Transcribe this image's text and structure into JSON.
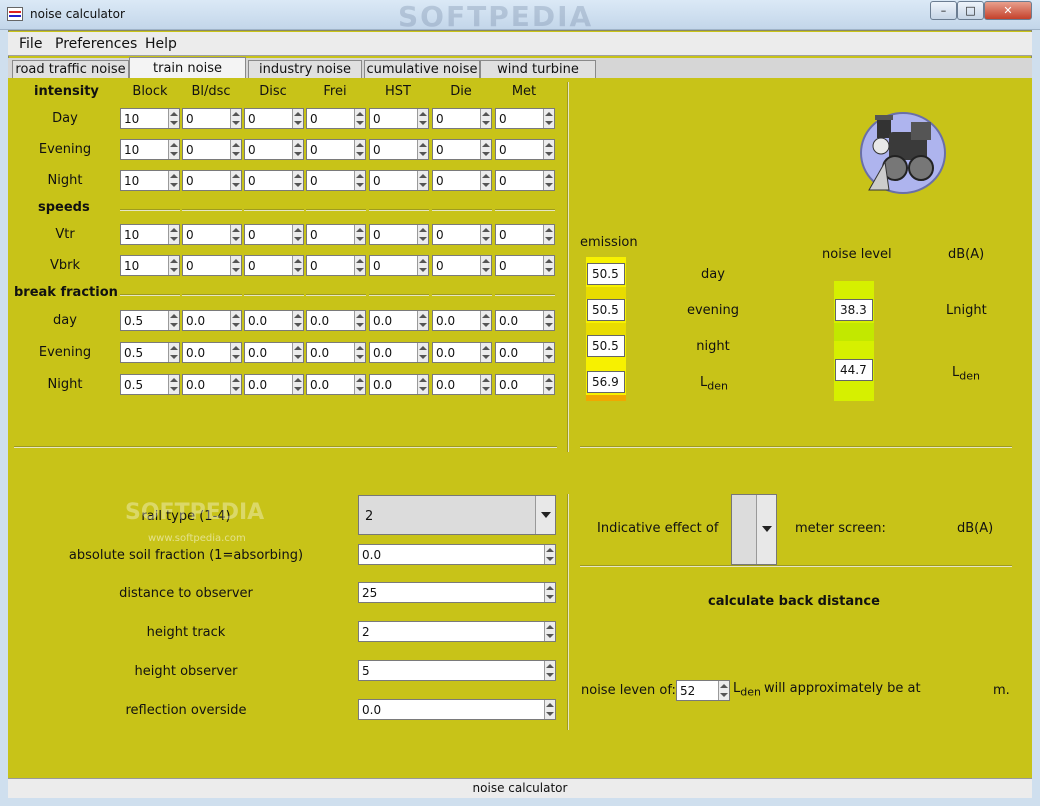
{
  "window": {
    "title": "noise calculator",
    "watermark": "SOFTPEDIA",
    "status": "noise calculator"
  },
  "controls": {
    "minimize": "–",
    "maximize": "□",
    "close": "✕"
  },
  "menu": [
    "File",
    "Preferences",
    "Help"
  ],
  "tabs": [
    "road traffic noise",
    "train noise",
    "industry noise",
    "cumulative noise",
    "wind turbine"
  ],
  "active_tab": "train noise",
  "grid": {
    "intensity_header": "intensity",
    "columns": [
      "Block",
      "Bl/dsc",
      "Disc",
      "Frei",
      "HST",
      "Die",
      "Met"
    ],
    "intensity_rows": [
      {
        "label": "Day",
        "values": [
          "10",
          "0",
          "0",
          "0",
          "0",
          "0",
          "0"
        ]
      },
      {
        "label": "Evening",
        "values": [
          "10",
          "0",
          "0",
          "0",
          "0",
          "0",
          "0"
        ]
      },
      {
        "label": "Night",
        "values": [
          "10",
          "0",
          "0",
          "0",
          "0",
          "0",
          "0"
        ]
      }
    ],
    "speeds_header": "speeds",
    "speed_rows": [
      {
        "label": "Vtr",
        "values": [
          "10",
          "0",
          "0",
          "0",
          "0",
          "0",
          "0"
        ]
      },
      {
        "label": "Vbrk",
        "values": [
          "10",
          "0",
          "0",
          "0",
          "0",
          "0",
          "0"
        ]
      }
    ],
    "break_header": "break fraction",
    "break_rows": [
      {
        "label": "day",
        "values": [
          "0.5",
          "0.0",
          "0.0",
          "0.0",
          "0.0",
          "0.0",
          "0.0"
        ]
      },
      {
        "label": "Evening",
        "values": [
          "0.5",
          "0.0",
          "0.0",
          "0.0",
          "0.0",
          "0.0",
          "0.0"
        ]
      },
      {
        "label": "Night",
        "values": [
          "0.5",
          "0.0",
          "0.0",
          "0.0",
          "0.0",
          "0.0",
          "0.0"
        ]
      }
    ]
  },
  "emission": {
    "header": "emission",
    "values": [
      "50.5",
      "50.5",
      "50.5",
      "56.9"
    ],
    "periods": [
      "day",
      "evening",
      "night",
      "L"
    ],
    "den_sub": "den"
  },
  "noise": {
    "header": "noise level",
    "unit": "dB(A)",
    "lnight_value": "38.3",
    "lnight_label": "Lnight",
    "lden_value": "44.7",
    "lden_label": "L",
    "lden_sub": "den"
  },
  "params": [
    {
      "label": "rail type (1-4)",
      "value": "2"
    },
    {
      "label": "absolute soil fraction (1=absorbing)",
      "value": "0.0"
    },
    {
      "label": "distance to observer",
      "value": "25"
    },
    {
      "label": "height track",
      "value": "2"
    },
    {
      "label": "height observer",
      "value": "5"
    },
    {
      "label": "reflection overside",
      "value": "0.0"
    }
  ],
  "screen": {
    "label": "Indicative effect of",
    "suffix": "meter screen:",
    "unit": "dB(A)"
  },
  "back_calc": {
    "title": "calculate back distance",
    "prefix": "noise leven of:",
    "value": "52",
    "lden_label": "L",
    "lden_sub": "den",
    "suffix": "will approximately be at",
    "unit": "m."
  },
  "watermark2": "SOFTPEDIA",
  "watermark3": "www.softpedia.com"
}
